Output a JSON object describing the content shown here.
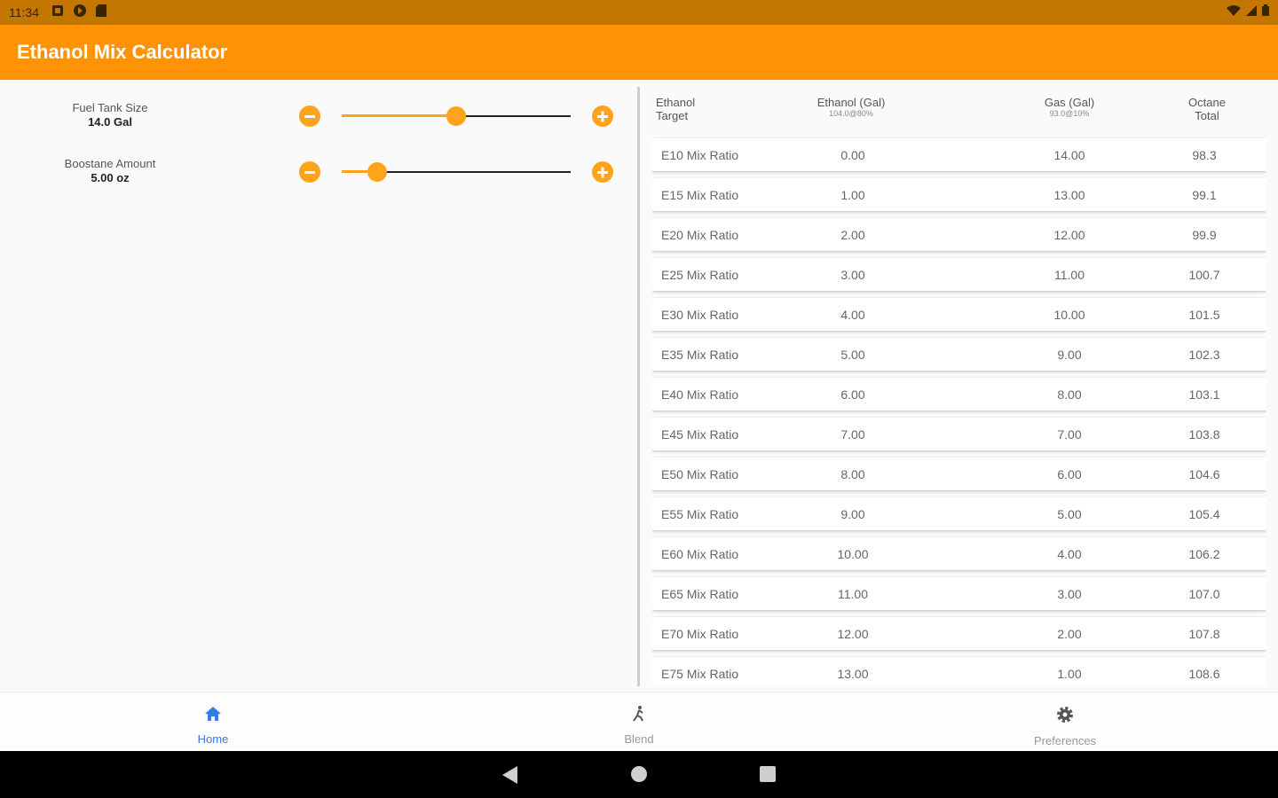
{
  "status_bar": {
    "time": "11:34"
  },
  "app_bar": {
    "title": "Ethanol Mix Calculator"
  },
  "controls": [
    {
      "label": "Fuel Tank Size",
      "value": "14.0 Gal",
      "slider_fraction": 0.5
    },
    {
      "label": "Boostane Amount",
      "value": "5.00 oz",
      "slider_fraction": 0.155
    }
  ],
  "table": {
    "headers": [
      {
        "line1": "Ethanol",
        "line2": "Target"
      },
      {
        "line1": "Ethanol (Gal)",
        "sub": "104.0@80%"
      },
      {
        "line1": "Gas (Gal)",
        "sub": "93.0@10%"
      },
      {
        "line1": "Octane",
        "line2": "Total"
      }
    ],
    "rows": [
      {
        "target": "E10 Mix Ratio",
        "ethanol": "0.00",
        "gas": "14.00",
        "octane": "98.3"
      },
      {
        "target": "E15 Mix Ratio",
        "ethanol": "1.00",
        "gas": "13.00",
        "octane": "99.1"
      },
      {
        "target": "E20 Mix Ratio",
        "ethanol": "2.00",
        "gas": "12.00",
        "octane": "99.9"
      },
      {
        "target": "E25 Mix Ratio",
        "ethanol": "3.00",
        "gas": "11.00",
        "octane": "100.7"
      },
      {
        "target": "E30 Mix Ratio",
        "ethanol": "4.00",
        "gas": "10.00",
        "octane": "101.5"
      },
      {
        "target": "E35 Mix Ratio",
        "ethanol": "5.00",
        "gas": "9.00",
        "octane": "102.3"
      },
      {
        "target": "E40 Mix Ratio",
        "ethanol": "6.00",
        "gas": "8.00",
        "octane": "103.1"
      },
      {
        "target": "E45 Mix Ratio",
        "ethanol": "7.00",
        "gas": "7.00",
        "octane": "103.8"
      },
      {
        "target": "E50 Mix Ratio",
        "ethanol": "8.00",
        "gas": "6.00",
        "octane": "104.6"
      },
      {
        "target": "E55 Mix Ratio",
        "ethanol": "9.00",
        "gas": "5.00",
        "octane": "105.4"
      },
      {
        "target": "E60 Mix Ratio",
        "ethanol": "10.00",
        "gas": "4.00",
        "octane": "106.2"
      },
      {
        "target": "E65 Mix Ratio",
        "ethanol": "11.00",
        "gas": "3.00",
        "octane": "107.0"
      },
      {
        "target": "E70 Mix Ratio",
        "ethanol": "12.00",
        "gas": "2.00",
        "octane": "107.8"
      },
      {
        "target": "E75 Mix Ratio",
        "ethanol": "13.00",
        "gas": "1.00",
        "octane": "108.6"
      }
    ]
  },
  "bottom_nav": [
    {
      "label": "Home",
      "icon": "home-icon",
      "active": true
    },
    {
      "label": "Blend",
      "icon": "blend-icon",
      "active": false
    },
    {
      "label": "Preferences",
      "icon": "gear-icon",
      "active": false
    }
  ],
  "colors": {
    "primary": "#ff9305",
    "status_bar": "#c37700",
    "accent": "#ffa31a",
    "active_nav": "#2f80ed"
  }
}
